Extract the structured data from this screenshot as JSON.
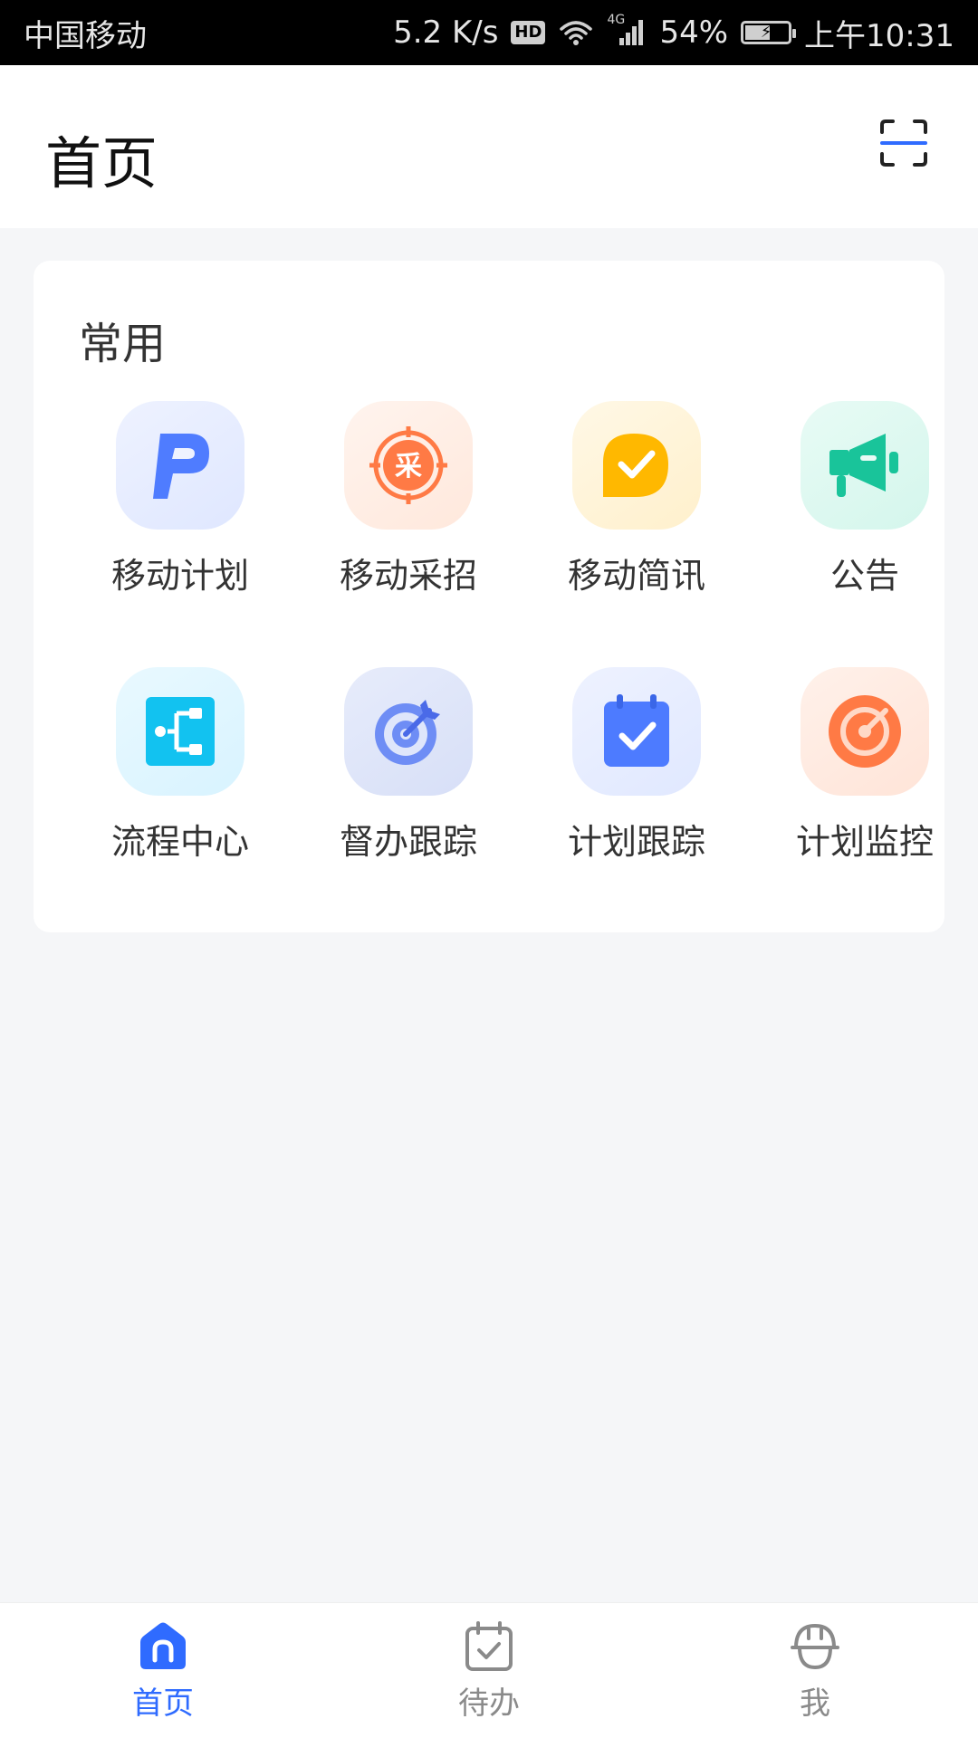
{
  "status_bar": {
    "carrier": "中国移动",
    "speed": "5.2 K/s",
    "hd": "HD",
    "network": "4G",
    "battery": "54%",
    "battery_level": 0.54,
    "time": "上午10:31"
  },
  "header": {
    "title": "首页",
    "scan_icon": "scan-icon"
  },
  "frequent": {
    "title": "常用",
    "items": [
      {
        "label": "移动计划",
        "icon": "p-logo-icon",
        "color": "#4f7cff"
      },
      {
        "label": "移动采招",
        "icon": "procurement-target-icon",
        "color": "#ff7a45"
      },
      {
        "label": "移动简讯",
        "icon": "message-check-icon",
        "color": "#ffb800"
      },
      {
        "label": "公告",
        "icon": "megaphone-icon",
        "color": "#19c49a"
      },
      {
        "label": "流程中心",
        "icon": "flow-icon",
        "color": "#12c2f0"
      },
      {
        "label": "督办跟踪",
        "icon": "target-arrow-icon",
        "color": "#5b7cf0"
      },
      {
        "label": "计划跟踪",
        "icon": "calendar-check-icon",
        "color": "#4d7bff"
      },
      {
        "label": "计划监控",
        "icon": "radar-icon",
        "color": "#ff6b3d"
      }
    ]
  },
  "tabbar": {
    "tabs": [
      {
        "label": "首页",
        "icon": "home-icon",
        "active": true
      },
      {
        "label": "待办",
        "icon": "todo-calendar-icon",
        "active": false
      },
      {
        "label": "我",
        "icon": "profile-helmet-icon",
        "active": false
      }
    ],
    "active_color": "#2f6bff",
    "inactive_color": "#8a8a8a"
  }
}
